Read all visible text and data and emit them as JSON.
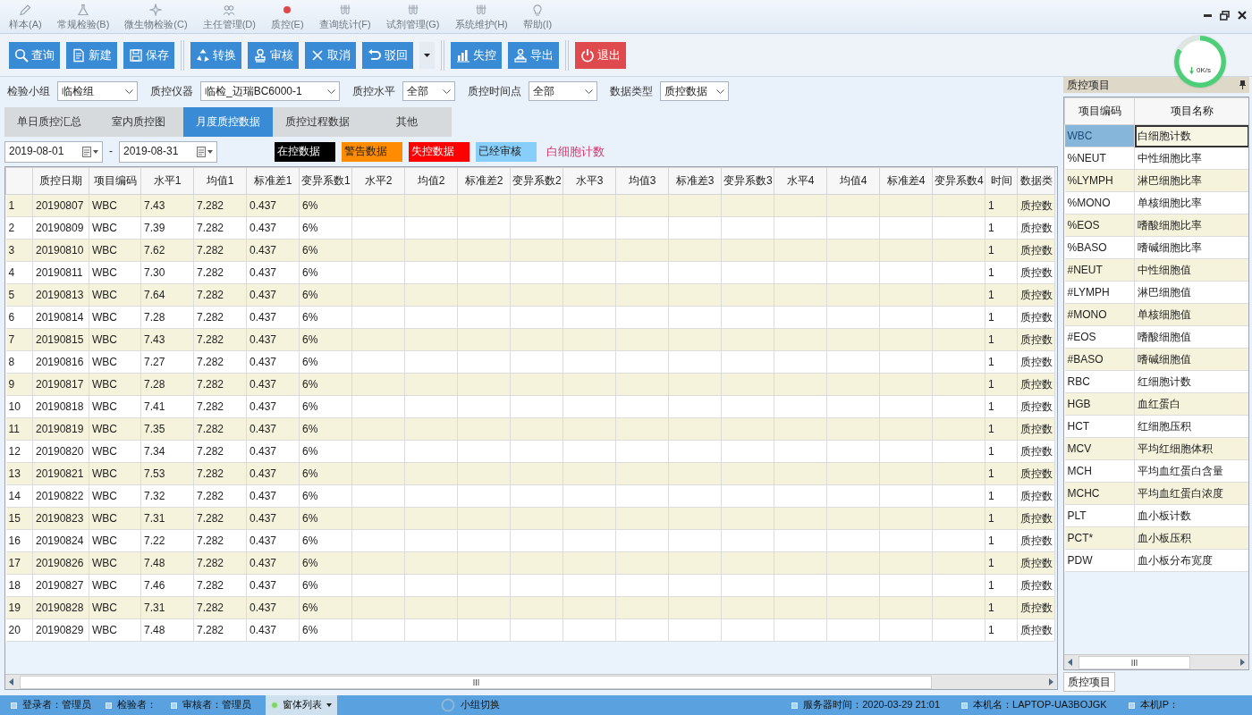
{
  "menu": [
    {
      "label": "样本(A)"
    },
    {
      "label": "常规检验(B)"
    },
    {
      "label": "微生物检验(C)"
    },
    {
      "label": "主任管理(D)"
    },
    {
      "label": "质控(E)"
    },
    {
      "label": "查询统计(F)"
    },
    {
      "label": "试剂管理(G)"
    },
    {
      "label": "系统维护(H)"
    },
    {
      "label": "帮助(I)"
    }
  ],
  "toolbar": [
    [
      {
        "kind": "action",
        "label": "查询"
      },
      {
        "kind": "action",
        "label": "新建"
      },
      {
        "kind": "action",
        "label": "保存"
      }
    ],
    [
      {
        "kind": "action",
        "label": "转换"
      },
      {
        "kind": "action",
        "label": "审核"
      },
      {
        "kind": "action",
        "label": "取消"
      },
      {
        "kind": "action",
        "label": "驳回"
      },
      {
        "kind": "dropdown"
      }
    ],
    [
      {
        "kind": "action",
        "label": "失控"
      },
      {
        "kind": "action",
        "label": "导出"
      }
    ],
    [
      {
        "kind": "danger",
        "label": "退出"
      }
    ]
  ],
  "filters": [
    {
      "label": "检验小组",
      "value": "临检组"
    },
    {
      "label": "质控仪器",
      "value": "临检_迈瑞BC6000-1"
    },
    {
      "label": "质控水平",
      "value": "全部"
    },
    {
      "label": "质控时间点",
      "value": "全部"
    },
    {
      "label": "数据类型",
      "value": "质控数据"
    }
  ],
  "tabs": [
    {
      "label": "单日质控汇总",
      "selected": false
    },
    {
      "label": "室内质控图",
      "selected": false
    },
    {
      "label": "月度质控数据",
      "selected": true
    },
    {
      "label": "质控过程数据",
      "selected": false
    },
    {
      "label": "其他",
      "selected": false
    }
  ],
  "date_range": {
    "start": "2019-08-01",
    "separator": "-",
    "end": "2019-08-31"
  },
  "legend": [
    {
      "label": "在控数据",
      "color": "#000000"
    },
    {
      "label": "警告数据",
      "color": "#ff8c00"
    },
    {
      "label": "失控数据",
      "color": "#ff0000"
    },
    {
      "label": "已经审核",
      "color": "#87cefa"
    }
  ],
  "current_item": "白细胞计数",
  "table": {
    "columns": [
      "质控日期",
      "项目编码",
      "水平1",
      "均值1",
      "标准差1",
      "变异系数1",
      "水平2",
      "均值2",
      "标准差2",
      "变异系数2",
      "水平3",
      "均值3",
      "标准差3",
      "变异系数3",
      "水平4",
      "均值4",
      "标准差4",
      "变异系数4",
      "时间",
      "数据类"
    ],
    "rows": [
      {
        "number": "1",
        "cells": [
          "20190807",
          "WBC",
          "7.43",
          "7.282",
          "0.437",
          "6%",
          null,
          null,
          null,
          null,
          null,
          null,
          null,
          null,
          null,
          null,
          null,
          null,
          "1",
          "质控数"
        ]
      },
      {
        "number": "2",
        "cells": [
          "20190809",
          "WBC",
          "7.39",
          "7.282",
          "0.437",
          "6%",
          null,
          null,
          null,
          null,
          null,
          null,
          null,
          null,
          null,
          null,
          null,
          null,
          "1",
          "质控数"
        ]
      },
      {
        "number": "3",
        "cells": [
          "20190810",
          "WBC",
          "7.62",
          "7.282",
          "0.437",
          "6%",
          null,
          null,
          null,
          null,
          null,
          null,
          null,
          null,
          null,
          null,
          null,
          null,
          "1",
          "质控数"
        ]
      },
      {
        "number": "4",
        "cells": [
          "20190811",
          "WBC",
          "7.30",
          "7.282",
          "0.437",
          "6%",
          null,
          null,
          null,
          null,
          null,
          null,
          null,
          null,
          null,
          null,
          null,
          null,
          "1",
          "质控数"
        ]
      },
      {
        "number": "5",
        "cells": [
          "20190813",
          "WBC",
          "7.64",
          "7.282",
          "0.437",
          "6%",
          null,
          null,
          null,
          null,
          null,
          null,
          null,
          null,
          null,
          null,
          null,
          null,
          "1",
          "质控数"
        ]
      },
      {
        "number": "6",
        "cells": [
          "20190814",
          "WBC",
          "7.28",
          "7.282",
          "0.437",
          "6%",
          null,
          null,
          null,
          null,
          null,
          null,
          null,
          null,
          null,
          null,
          null,
          null,
          "1",
          "质控数"
        ]
      },
      {
        "number": "7",
        "cells": [
          "20190815",
          "WBC",
          "7.43",
          "7.282",
          "0.437",
          "6%",
          null,
          null,
          null,
          null,
          null,
          null,
          null,
          null,
          null,
          null,
          null,
          null,
          "1",
          "质控数"
        ]
      },
      {
        "number": "8",
        "cells": [
          "20190816",
          "WBC",
          "7.27",
          "7.282",
          "0.437",
          "6%",
          null,
          null,
          null,
          null,
          null,
          null,
          null,
          null,
          null,
          null,
          null,
          null,
          "1",
          "质控数"
        ]
      },
      {
        "number": "9",
        "cells": [
          "20190817",
          "WBC",
          "7.28",
          "7.282",
          "0.437",
          "6%",
          null,
          null,
          null,
          null,
          null,
          null,
          null,
          null,
          null,
          null,
          null,
          null,
          "1",
          "质控数"
        ]
      },
      {
        "number": "10",
        "cells": [
          "20190818",
          "WBC",
          "7.41",
          "7.282",
          "0.437",
          "6%",
          null,
          null,
          null,
          null,
          null,
          null,
          null,
          null,
          null,
          null,
          null,
          null,
          "1",
          "质控数"
        ]
      },
      {
        "number": "11",
        "cells": [
          "20190819",
          "WBC",
          "7.35",
          "7.282",
          "0.437",
          "6%",
          null,
          null,
          null,
          null,
          null,
          null,
          null,
          null,
          null,
          null,
          null,
          null,
          "1",
          "质控数"
        ]
      },
      {
        "number": "12",
        "cells": [
          "20190820",
          "WBC",
          "7.34",
          "7.282",
          "0.437",
          "6%",
          null,
          null,
          null,
          null,
          null,
          null,
          null,
          null,
          null,
          null,
          null,
          null,
          "1",
          "质控数"
        ]
      },
      {
        "number": "13",
        "cells": [
          "20190821",
          "WBC",
          "7.53",
          "7.282",
          "0.437",
          "6%",
          null,
          null,
          null,
          null,
          null,
          null,
          null,
          null,
          null,
          null,
          null,
          null,
          "1",
          "质控数"
        ]
      },
      {
        "number": "14",
        "cells": [
          "20190822",
          "WBC",
          "7.32",
          "7.282",
          "0.437",
          "6%",
          null,
          null,
          null,
          null,
          null,
          null,
          null,
          null,
          null,
          null,
          null,
          null,
          "1",
          "质控数"
        ]
      },
      {
        "number": "15",
        "cells": [
          "20190823",
          "WBC",
          "7.31",
          "7.282",
          "0.437",
          "6%",
          null,
          null,
          null,
          null,
          null,
          null,
          null,
          null,
          null,
          null,
          null,
          null,
          "1",
          "质控数"
        ]
      },
      {
        "number": "16",
        "cells": [
          "20190824",
          "WBC",
          "7.22",
          "7.282",
          "0.437",
          "6%",
          null,
          null,
          null,
          null,
          null,
          null,
          null,
          null,
          null,
          null,
          null,
          null,
          "1",
          "质控数"
        ]
      },
      {
        "number": "17",
        "cells": [
          "20190826",
          "WBC",
          "7.48",
          "7.282",
          "0.437",
          "6%",
          null,
          null,
          null,
          null,
          null,
          null,
          null,
          null,
          null,
          null,
          null,
          null,
          "1",
          "质控数"
        ]
      },
      {
        "number": "18",
        "cells": [
          "20190827",
          "WBC",
          "7.46",
          "7.282",
          "0.437",
          "6%",
          null,
          null,
          null,
          null,
          null,
          null,
          null,
          null,
          null,
          null,
          null,
          null,
          "1",
          "质控数"
        ]
      },
      {
        "number": "19",
        "cells": [
          "20190828",
          "WBC",
          "7.31",
          "7.282",
          "0.437",
          "6%",
          null,
          null,
          null,
          null,
          null,
          null,
          null,
          null,
          null,
          null,
          null,
          null,
          "1",
          "质控数"
        ]
      },
      {
        "number": "20",
        "cells": [
          "20190829",
          "WBC",
          "7.48",
          "7.282",
          "0.437",
          "6%",
          null,
          null,
          null,
          null,
          null,
          null,
          null,
          null,
          null,
          null,
          null,
          null,
          "1",
          "质控数"
        ]
      }
    ]
  },
  "side_panel": {
    "title": "质控项目",
    "columns": [
      "项目编码",
      "项目名称"
    ],
    "rows": [
      {
        "code": "WBC",
        "name": "白细胞计数",
        "selected": true
      },
      {
        "code": "%NEUT",
        "name": "中性细胞比率",
        "selected": false
      },
      {
        "code": "%LYMPH",
        "name": "淋巴细胞比率",
        "selected": false
      },
      {
        "code": "%MONO",
        "name": "单核细胞比率",
        "selected": false
      },
      {
        "code": "%EOS",
        "name": "嗜酸细胞比率",
        "selected": false
      },
      {
        "code": "%BASO",
        "name": "嗜碱细胞比率",
        "selected": false
      },
      {
        "code": "#NEUT",
        "name": "中性细胞值",
        "selected": false
      },
      {
        "code": "#LYMPH",
        "name": "淋巴细胞值",
        "selected": false
      },
      {
        "code": "#MONO",
        "name": "单核细胞值",
        "selected": false
      },
      {
        "code": "#EOS",
        "name": "嗜酸细胞值",
        "selected": false
      },
      {
        "code": "#BASO",
        "name": "嗜碱细胞值",
        "selected": false
      },
      {
        "code": "RBC",
        "name": "红细胞计数",
        "selected": false
      },
      {
        "code": "HGB",
        "name": "血红蛋白",
        "selected": false
      },
      {
        "code": "HCT",
        "name": "红细胞压积",
        "selected": false
      },
      {
        "code": "MCV",
        "name": "平均红细胞体积",
        "selected": false
      },
      {
        "code": "MCH",
        "name": "平均血红蛋白含量",
        "selected": false
      },
      {
        "code": "MCHC",
        "name": "平均血红蛋白浓度",
        "selected": false
      },
      {
        "code": "PLT",
        "name": "血小板计数",
        "selected": false
      },
      {
        "code": "PCT*",
        "name": "血小板压积",
        "selected": false
      },
      {
        "code": "PDW",
        "name": "血小板分布宽度",
        "selected": false
      }
    ],
    "tab": "质控项目"
  },
  "status_bar": {
    "left": [
      {
        "kind": "info",
        "label": "登录者：管理员"
      },
      {
        "kind": "info",
        "label": "检验者："
      },
      {
        "kind": "info",
        "label": "审核者：管理员"
      },
      {
        "kind": "menu",
        "label": "窗体列表"
      }
    ],
    "center": [
      {
        "kind": "switch",
        "label": "小组切换"
      }
    ],
    "right": [
      {
        "kind": "info",
        "label": "服务器时间：2020-03-29 21:01"
      },
      {
        "kind": "info",
        "label": "本机名：LAPTOP-UA3BOJGK"
      },
      {
        "kind": "info",
        "label": "本机IP："
      }
    ]
  },
  "speed_meter": {
    "reading": "0K/s"
  }
}
